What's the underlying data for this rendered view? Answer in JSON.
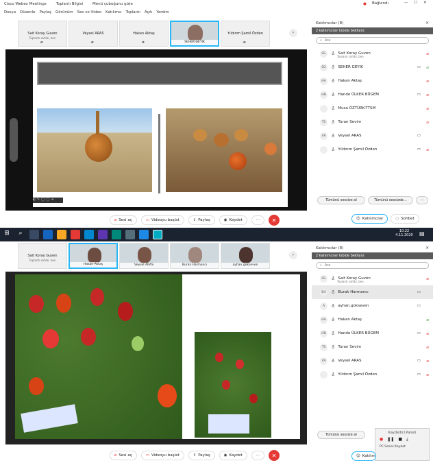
{
  "s1": {
    "titlebar": {
      "app": "Cisco Webex Meetings",
      "info": "Toplantı Bilgisi",
      "menu_hide": "Menü çubuğunu gizle",
      "user": "Bağlandı"
    },
    "menu": [
      "Dosya",
      "Düzenle",
      "Paylaş",
      "Görünüm",
      "Ses ve Video",
      "Katılımcı",
      "Toplantı",
      "Açık",
      "Yardım"
    ],
    "thumbs": [
      {
        "name": "Sait Koray Guven",
        "sub": "Toplantı sahibi, ben"
      },
      {
        "name": "Veysel ARAS",
        "sub": ""
      },
      {
        "name": "Hakan Aktaş",
        "sub": ""
      },
      {
        "name": "SEHER GEYIK",
        "sub": "",
        "video": true
      },
      {
        "name": "Yıldırım Şamil Özden",
        "sub": ""
      }
    ],
    "controls": {
      "audio": "Sesi aç",
      "video": "Videoyu başlat",
      "share": "Paylaş",
      "record": "Kaydet"
    },
    "panel": {
      "title": "Katılımcılar (8)",
      "lobby": "2 katılımcılar lobide bekliyor.",
      "search": "Ara",
      "people": [
        {
          "i": "SG",
          "name": "Sait Koray Guven",
          "sub": "Toplantı sahibi, ben"
        },
        {
          "i": "SG",
          "name": "SEHER GEYIK",
          "sub": ""
        },
        {
          "i": "HA",
          "name": "Hakan Aktaş",
          "sub": ""
        },
        {
          "i": "HB",
          "name": "Hande ÜLKER BÜGEM",
          "sub": ""
        },
        {
          "i": "",
          "name": "Musa ÖZTÜRK-TTSM",
          "sub": ""
        },
        {
          "i": "TS",
          "name": "Turan Sevim",
          "sub": ""
        },
        {
          "i": "VA",
          "name": "Veysel ARAS",
          "sub": ""
        },
        {
          "i": "",
          "name": "Yıldırım Şamil Özden",
          "sub": ""
        }
      ],
      "btn_mute_all": "Tümünü sessize al",
      "btn_unmute_all": "Tümünü sessizde..."
    },
    "bottom": {
      "participants": "Katılımcılar",
      "chat": "Sohbet"
    }
  },
  "taskbar": {
    "time": "10:22",
    "date": "4.11.2020"
  },
  "s2": {
    "thumbs": [
      {
        "name": "Sait Koray Guven",
        "sub": "Toplantı sahibi, ben"
      },
      {
        "name": "Hakan Aktaş",
        "sub": ""
      },
      {
        "name": "Veysel ARAS",
        "sub": ""
      },
      {
        "name": "Burak Harmancı",
        "sub": ""
      },
      {
        "name": "ayhan.gokseven",
        "sub": ""
      }
    ],
    "controls": {
      "audio": "Sesi aç",
      "video": "Videoyu başlat",
      "share": "Paylaş",
      "record": "Kaydet"
    },
    "panel": {
      "title": "Katılımcılar (8)",
      "lobby": "2 katılımcılar lobide bekliyor.",
      "search": "Ara",
      "people": [
        {
          "i": "SG",
          "name": "Sait Koray Guven",
          "sub": "Toplantı sahibi, ben"
        },
        {
          "i": "BH",
          "name": "Burak Harmancı",
          "sub": ""
        },
        {
          "i": "A",
          "name": "ayhan.gokseven",
          "sub": ""
        },
        {
          "i": "HA",
          "name": "Hakan Aktaş",
          "sub": ""
        },
        {
          "i": "HB",
          "name": "Hande ÜLKER BÜGEM",
          "sub": ""
        },
        {
          "i": "TS",
          "name": "Turan Sevim",
          "sub": ""
        },
        {
          "i": "VA",
          "name": "Veysel ARAS",
          "sub": ""
        },
        {
          "i": "",
          "name": "Yıldırım Şamil Özden",
          "sub": ""
        }
      ],
      "btn_mute_all": "Tümünü sessize al",
      "recorder_title": "Kaydedici Paneli",
      "recorder_status": "PC Sesini Kaydet"
    },
    "bottom": {
      "participants": "Katılım"
    }
  }
}
